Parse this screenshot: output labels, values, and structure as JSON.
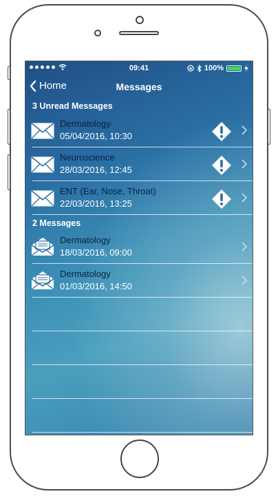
{
  "status_bar": {
    "time": "09:41",
    "battery": "100%"
  },
  "nav": {
    "back_label": "Home",
    "title": "Messages"
  },
  "sections": [
    {
      "header": "3 Unread Messages",
      "items": [
        {
          "subject": "Dermatology",
          "date": "05/04/2016, 10:30",
          "icon": "envelope-closed-icon",
          "alert": true
        },
        {
          "subject": "Neuroscience",
          "date": "28/03/2016, 12:45",
          "icon": "envelope-closed-icon",
          "alert": true
        },
        {
          "subject": "ENT (Ear, Nose, Throat)",
          "date": "22/03/2016, 13:25",
          "icon": "envelope-closed-icon",
          "alert": true
        }
      ]
    },
    {
      "header": "2 Messages",
      "items": [
        {
          "subject": "Dermatology",
          "date": "18/03/2016, 09:00",
          "icon": "envelope-open-icon",
          "alert": false
        },
        {
          "subject": "Dermatology",
          "date": "01/03/2016, 14:50",
          "icon": "envelope-open-icon",
          "alert": false
        }
      ]
    }
  ]
}
